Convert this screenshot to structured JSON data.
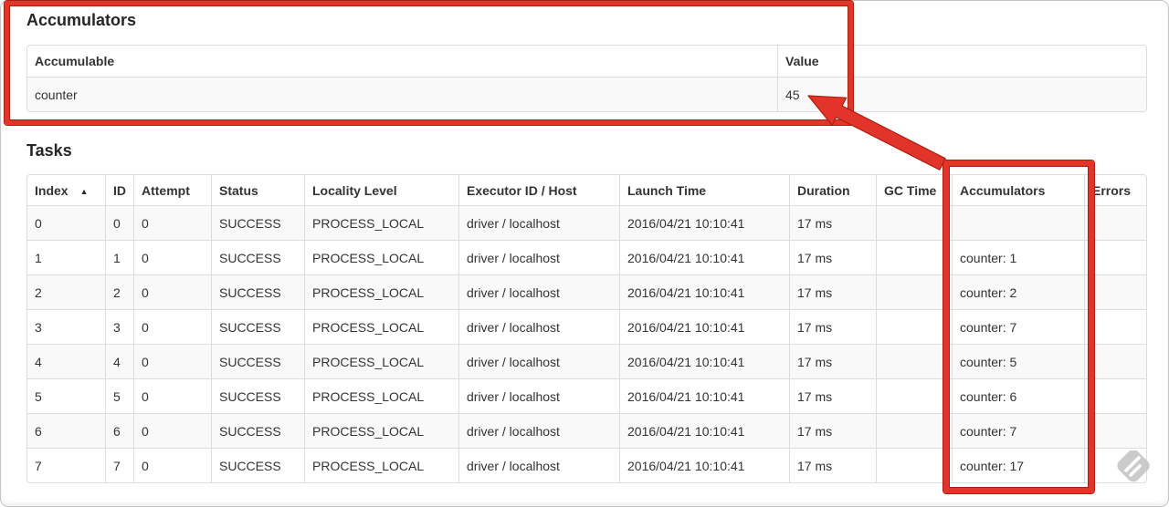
{
  "accumulators_section": {
    "heading": "Accumulators",
    "table": {
      "headers": [
        "Accumulable",
        "Value"
      ],
      "rows": [
        [
          "counter",
          "45"
        ]
      ]
    }
  },
  "tasks_section": {
    "heading": "Tasks",
    "table": {
      "headers": [
        "Index",
        "ID",
        "Attempt",
        "Status",
        "Locality Level",
        "Executor ID / Host",
        "Launch Time",
        "Duration",
        "GC Time",
        "Accumulators",
        "Errors"
      ],
      "sorted_column": "Index",
      "sort_icon": "▲",
      "rows": [
        [
          "0",
          "0",
          "0",
          "SUCCESS",
          "PROCESS_LOCAL",
          "driver / localhost",
          "2016/04/21 10:10:41",
          "17 ms",
          "",
          "",
          ""
        ],
        [
          "1",
          "1",
          "0",
          "SUCCESS",
          "PROCESS_LOCAL",
          "driver / localhost",
          "2016/04/21 10:10:41",
          "17 ms",
          "",
          "counter: 1",
          ""
        ],
        [
          "2",
          "2",
          "0",
          "SUCCESS",
          "PROCESS_LOCAL",
          "driver / localhost",
          "2016/04/21 10:10:41",
          "17 ms",
          "",
          "counter: 2",
          ""
        ],
        [
          "3",
          "3",
          "0",
          "SUCCESS",
          "PROCESS_LOCAL",
          "driver / localhost",
          "2016/04/21 10:10:41",
          "17 ms",
          "",
          "counter: 7",
          ""
        ],
        [
          "4",
          "4",
          "0",
          "SUCCESS",
          "PROCESS_LOCAL",
          "driver / localhost",
          "2016/04/21 10:10:41",
          "17 ms",
          "",
          "counter: 5",
          ""
        ],
        [
          "5",
          "5",
          "0",
          "SUCCESS",
          "PROCESS_LOCAL",
          "driver / localhost",
          "2016/04/21 10:10:41",
          "17 ms",
          "",
          "counter: 6",
          ""
        ],
        [
          "6",
          "6",
          "0",
          "SUCCESS",
          "PROCESS_LOCAL",
          "driver / localhost",
          "2016/04/21 10:10:41",
          "17 ms",
          "",
          "counter: 7",
          ""
        ],
        [
          "7",
          "7",
          "0",
          "SUCCESS",
          "PROCESS_LOCAL",
          "driver / localhost",
          "2016/04/21 10:10:41",
          "17 ms",
          "",
          "counter: 17",
          ""
        ]
      ]
    }
  },
  "annotations": {
    "highlight_color": "#e23429",
    "arrow_target_value": "45"
  }
}
